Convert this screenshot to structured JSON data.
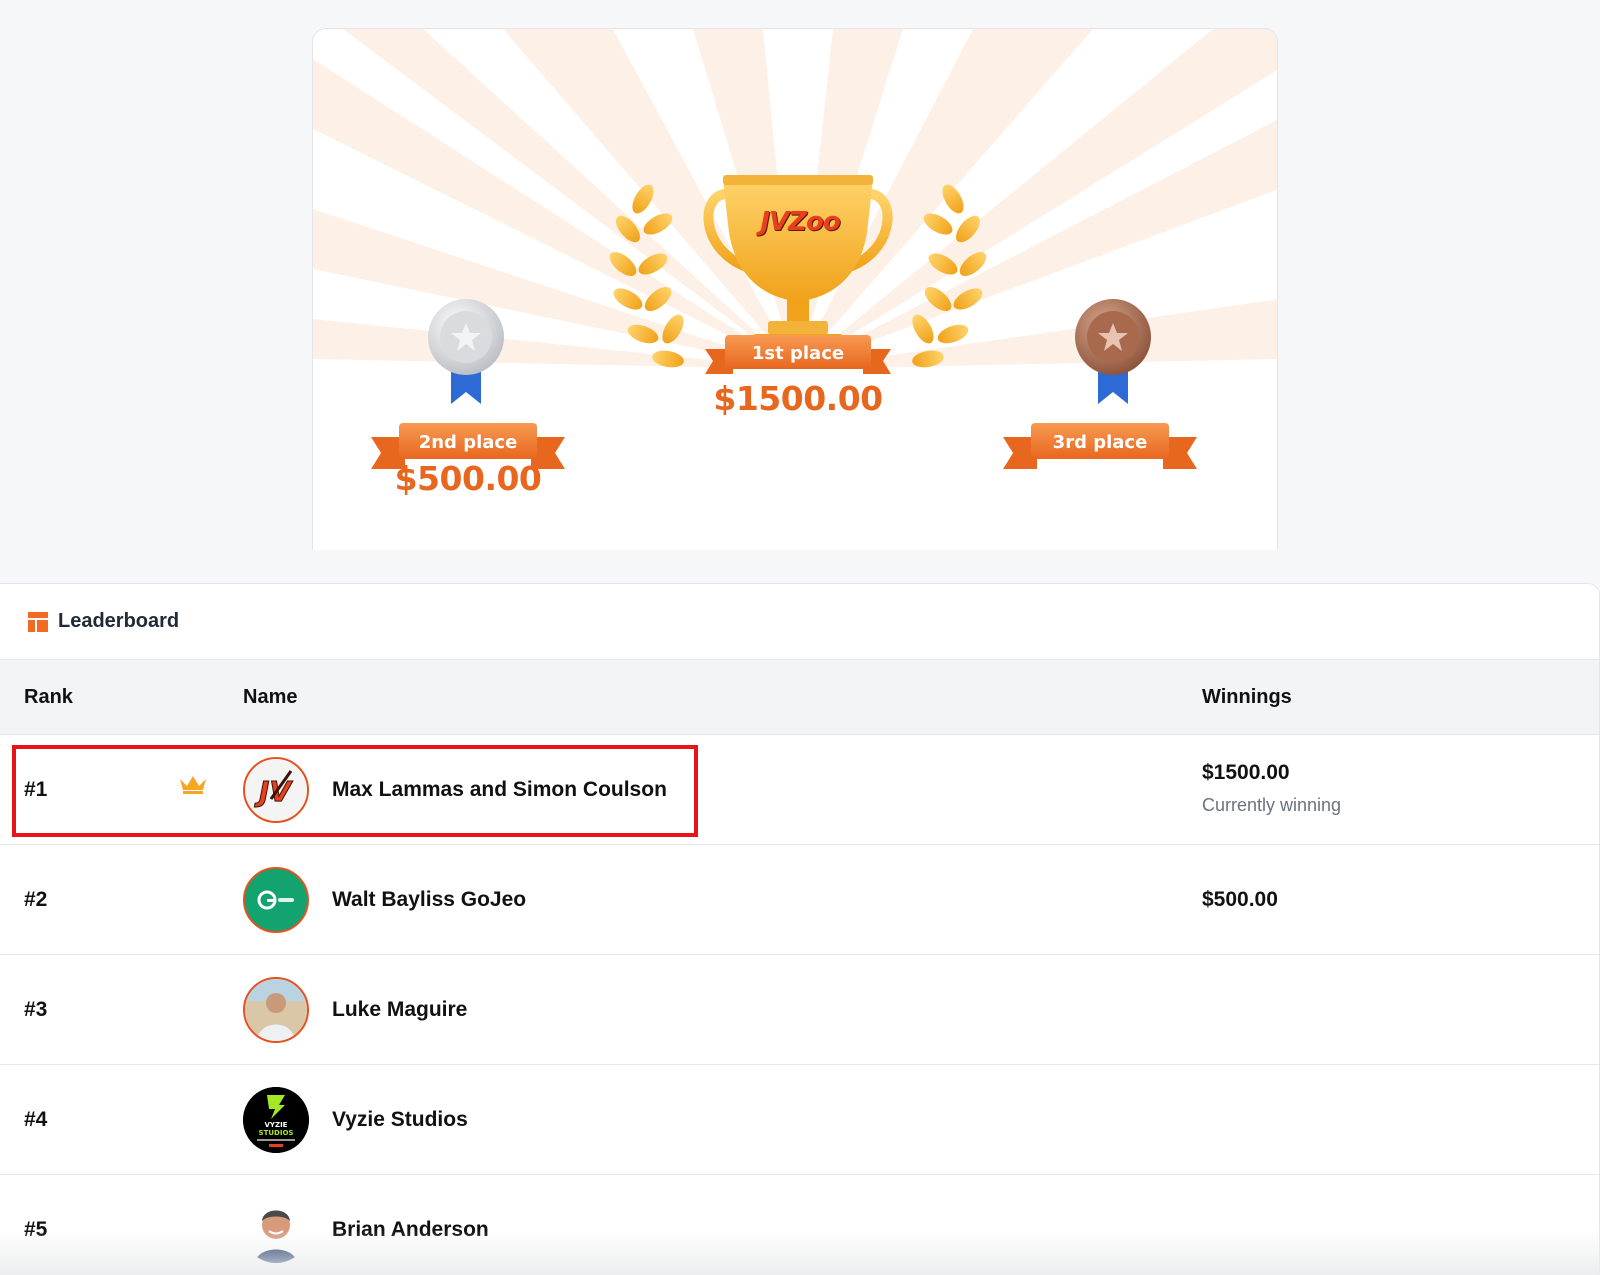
{
  "prizes": {
    "first": {
      "label": "1st place",
      "amount": "$1500.00"
    },
    "second": {
      "label": "2nd place",
      "amount": "$500.00"
    },
    "third": {
      "label": "3rd place"
    },
    "trophy_logo": "JVZoo"
  },
  "leaderboard": {
    "title": "Leaderboard",
    "icon": "layout-icon",
    "columns": {
      "rank": "Rank",
      "name": "Name",
      "winnings": "Winnings"
    },
    "rows": [
      {
        "rank": "#1",
        "name": "Max Lammas and Simon Coulson",
        "winnings": "$1500.00",
        "status": "Currently winning",
        "crown": true,
        "avatar": "jv-logo-avatar"
      },
      {
        "rank": "#2",
        "name": "Walt Bayliss GoJeo",
        "winnings": "$500.00",
        "avatar": "gojeo-logo-avatar"
      },
      {
        "rank": "#3",
        "name": "Luke Maguire",
        "avatar": "photo-avatar"
      },
      {
        "rank": "#4",
        "name": "Vyzie Studios",
        "avatar": "vyzie-logo-avatar",
        "avatar_text": [
          "VYZIE",
          "STUDIOS"
        ]
      },
      {
        "rank": "#5",
        "name": "Brian Anderson",
        "avatar": "photo-avatar"
      }
    ]
  },
  "colors": {
    "accent": "#e8671f",
    "highlight": "#e8141a",
    "gold": "#f5a623"
  }
}
